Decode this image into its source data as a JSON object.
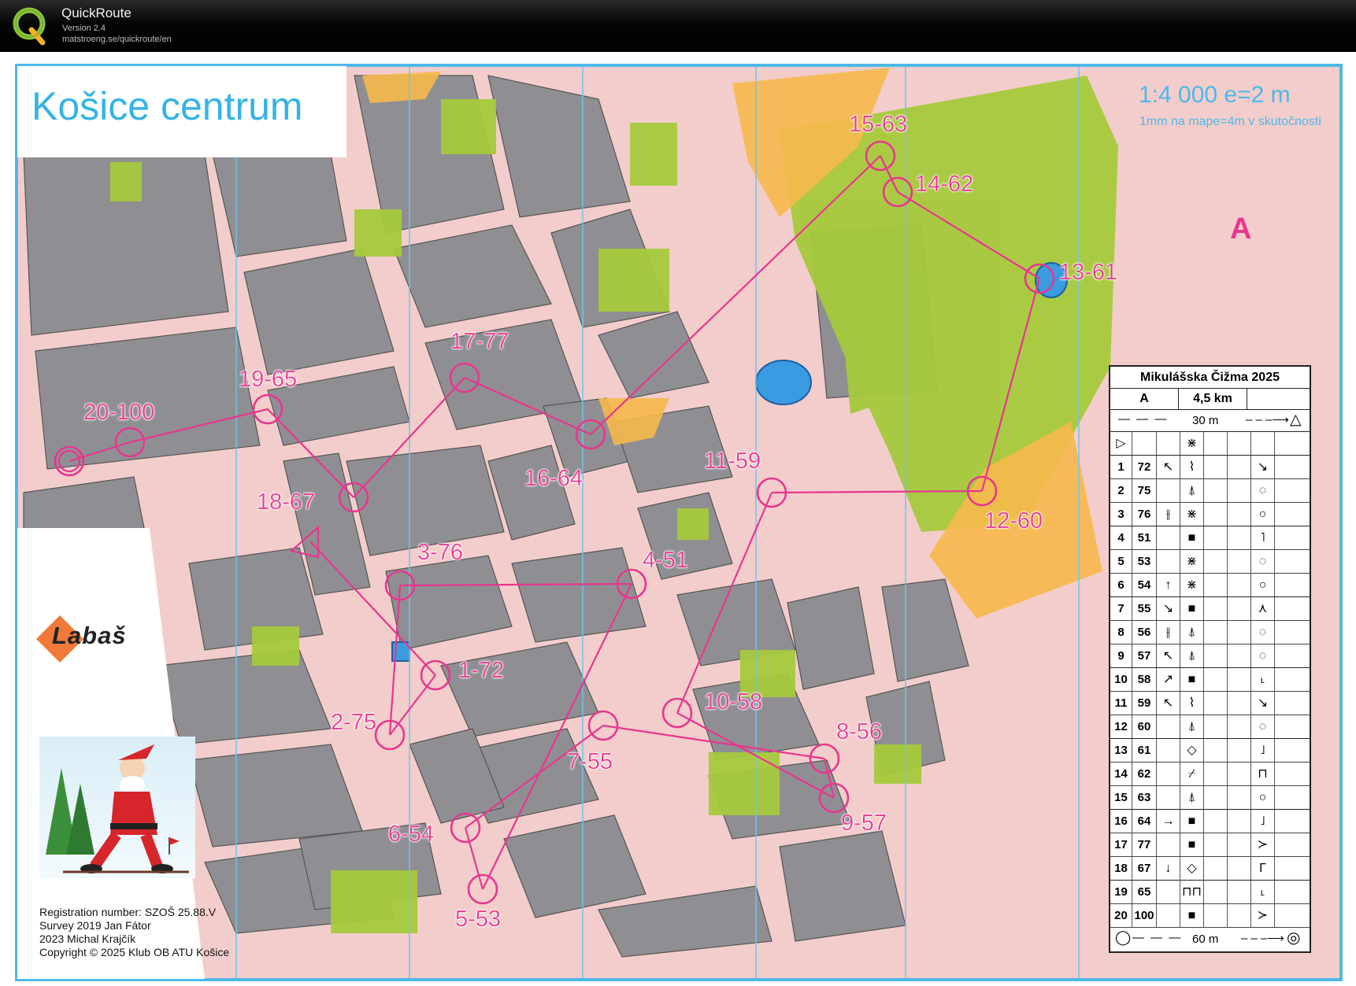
{
  "app": {
    "name": "QuickRoute",
    "version": "Version 2.4",
    "url": "matstroeng.se/quickroute/en"
  },
  "map": {
    "title": "Košice centrum",
    "scale": "1:4 000  e=2 m",
    "scale_note": "1mm na mape=4m v skutočnosti",
    "course_letter": "A",
    "sponsor": "Labaš",
    "colors": {
      "course": "#e8368f",
      "frame": "#4db8e8",
      "buildings": "#8f8f93",
      "paved": "#f3cdcb",
      "vegetation": "#a6c93c",
      "open": "#f6b94b",
      "water": "#3a9be0"
    },
    "controls": [
      {
        "label": "1-72"
      },
      {
        "label": "2-75"
      },
      {
        "label": "3-76"
      },
      {
        "label": "4-51"
      },
      {
        "label": "5-53"
      },
      {
        "label": "6-54"
      },
      {
        "label": "7-55"
      },
      {
        "label": "8-56"
      },
      {
        "label": "9-57"
      },
      {
        "label": "10-58"
      },
      {
        "label": "11-59"
      },
      {
        "label": "12-60"
      },
      {
        "label": "13-61"
      },
      {
        "label": "14-62"
      },
      {
        "label": "15-63"
      },
      {
        "label": "16-64"
      },
      {
        "label": "17-77"
      },
      {
        "label": "18-67"
      },
      {
        "label": "19-65"
      },
      {
        "label": "20-100"
      }
    ],
    "credits": [
      "Registration number: SZOŠ 25.88.V",
      "Survey 2019 Jan Fátor",
      "2023 Michal Krajčík",
      "Copyright © 2025 Klub OB ATU Košice"
    ]
  },
  "description_sheet": {
    "event": "Mikulášska Čižma 2025",
    "course": "A",
    "length": "4,5 km",
    "start_distance": "30 m",
    "finish_distance": "60 m",
    "rows": [
      {
        "n": "1",
        "code": "72",
        "dir": "↖",
        "feature": "⌇",
        "where": "↘"
      },
      {
        "n": "2",
        "code": "75",
        "dir": "",
        "feature": "⍋",
        "where": "◌"
      },
      {
        "n": "3",
        "code": "76",
        "dir": "⫲",
        "feature": "⋇",
        "where": "○"
      },
      {
        "n": "4",
        "code": "51",
        "dir": "",
        "feature": "■",
        "where": "˥"
      },
      {
        "n": "5",
        "code": "53",
        "dir": "",
        "feature": "⋇",
        "where": "◌"
      },
      {
        "n": "6",
        "code": "54",
        "dir": "↑",
        "feature": "⋇",
        "where": "○"
      },
      {
        "n": "7",
        "code": "55",
        "dir": "↘",
        "feature": "■",
        "where": "⋏"
      },
      {
        "n": "8",
        "code": "56",
        "dir": "⫲",
        "feature": "⍋",
        "where": "◌"
      },
      {
        "n": "9",
        "code": "57",
        "dir": "↖",
        "feature": "⍋",
        "where": "◌"
      },
      {
        "n": "10",
        "code": "58",
        "dir": "↗",
        "feature": "■",
        "where": "˪"
      },
      {
        "n": "11",
        "code": "59",
        "dir": "↖",
        "feature": "⌇",
        "where": "↘"
      },
      {
        "n": "12",
        "code": "60",
        "dir": "",
        "feature": "⍋",
        "where": "◌"
      },
      {
        "n": "13",
        "code": "61",
        "dir": "",
        "feature": "◇",
        "where": "˩"
      },
      {
        "n": "14",
        "code": "62",
        "dir": "",
        "feature": "⌿",
        "where": "⊓"
      },
      {
        "n": "15",
        "code": "63",
        "dir": "",
        "feature": "⍋",
        "where": "○"
      },
      {
        "n": "16",
        "code": "64",
        "dir": "→",
        "feature": "■",
        "where": "˩"
      },
      {
        "n": "17",
        "code": "77",
        "dir": "",
        "feature": "■",
        "where": "≻"
      },
      {
        "n": "18",
        "code": "67",
        "dir": "↓",
        "feature": "◇",
        "where": "Γ"
      },
      {
        "n": "19",
        "code": "65",
        "dir": "",
        "feature": "⊓⊓",
        "where": "˪"
      },
      {
        "n": "20",
        "code": "100",
        "dir": "",
        "feature": "■",
        "where": "≻"
      }
    ]
  }
}
